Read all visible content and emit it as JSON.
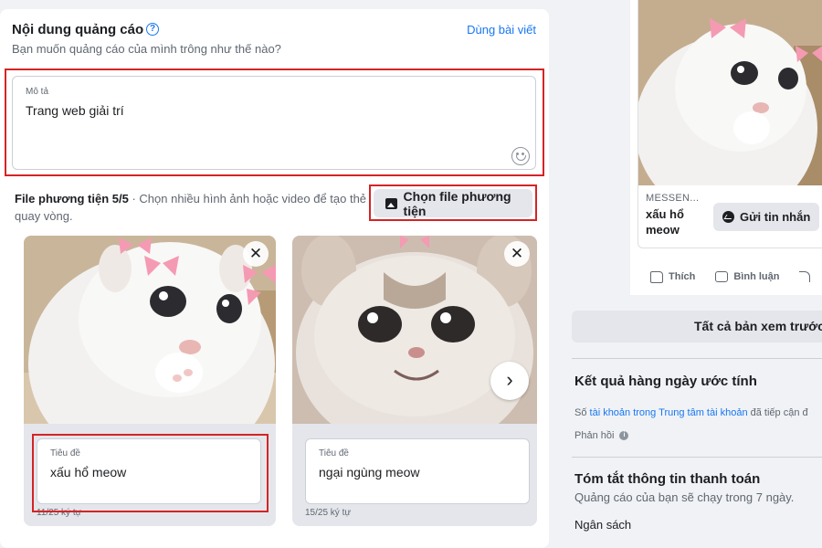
{
  "ad_content": {
    "title": "Nội dung quảng cáo",
    "subtitle": "Bạn muốn quảng cáo của mình trông như thế nào?",
    "use_post_link": "Dùng bài viết",
    "help_icon": "?"
  },
  "description": {
    "label": "Mô tả",
    "value": "Trang web giải trí"
  },
  "media": {
    "heading": "File phương tiện 5/5",
    "hint": " · Chọn nhiều hình ảnh hoặc video để tạo thẻ quay vòng.",
    "choose_button": "Chọn file phương tiện"
  },
  "cards": [
    {
      "title_label": "Tiêu đề",
      "title_value": "xấu hổ meow",
      "char_count": "11/25 ký tự",
      "close": "✕"
    },
    {
      "title_label": "Tiêu đề",
      "title_value": "ngại ngùng meow",
      "char_count": "15/25 ký tự",
      "close": "✕",
      "next": "›"
    }
  ],
  "preview": {
    "source": "MESSEN...",
    "headline": "xấu hổ meow",
    "send_button": "Gửi tin nhắn",
    "actions": {
      "like": "Thích",
      "comment": "Bình luận"
    }
  },
  "all_previews_button": "Tất cả bản xem trước",
  "daily_results": {
    "title": "Kết quả hàng ngày ước tính",
    "line_prefix": "Số ",
    "line_link": "tài khoản trong Trung tâm tài khoản",
    "line_suffix": " đã tiếp cận đ",
    "feedback": "Phản hồi",
    "info_icon": "i"
  },
  "payment": {
    "title": "Tóm tắt thông tin thanh toán",
    "subtitle": "Quảng cáo của bạn sẽ chạy trong 7 ngày.",
    "budget": "Ngân sách"
  },
  "colors": {
    "accent": "#1877f2",
    "highlight": "#d42426",
    "panel": "#ffffff",
    "background": "#f0f2f5"
  }
}
